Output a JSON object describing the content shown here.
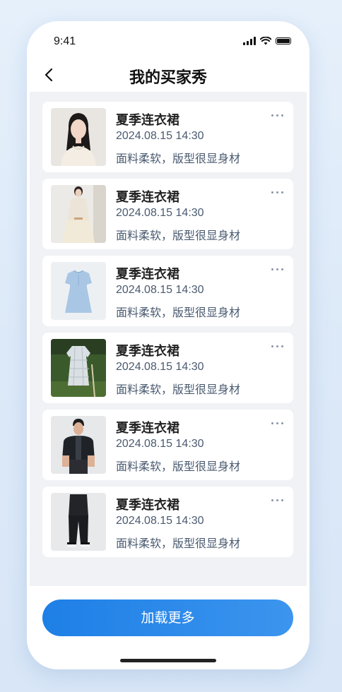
{
  "status": {
    "time": "9:41"
  },
  "nav": {
    "title": "我的买家秀"
  },
  "items": [
    {
      "title": "夏季连衣裙",
      "time": "2024.08.15 14:30",
      "desc": "面料柔软，版型很显身材",
      "image": "woman-portrait"
    },
    {
      "title": "夏季连衣裙",
      "time": "2024.08.15 14:30",
      "desc": "面料柔软，版型很显身材",
      "image": "woman-full-body-dress"
    },
    {
      "title": "夏季连衣裙",
      "time": "2024.08.15 14:30",
      "desc": "面料柔软，版型很显身材",
      "image": "blue-dress-product"
    },
    {
      "title": "夏季连衣裙",
      "time": "2024.08.15 14:30",
      "desc": "面料柔软，版型很显身材",
      "image": "plaid-dress-outdoor"
    },
    {
      "title": "夏季连衣裙",
      "time": "2024.08.15 14:30",
      "desc": "面料柔软，版型很显身材",
      "image": "man-shirt"
    },
    {
      "title": "夏季连衣裙",
      "time": "2024.08.15 14:30",
      "desc": "面料柔软，版型很显身材",
      "image": "man-full-body-pants"
    }
  ],
  "footer": {
    "load_more_label": "加载更多"
  },
  "colors": {
    "accent": "#1e7fe6",
    "background": "#f0f2f5",
    "text_secondary": "#4a5a70"
  }
}
